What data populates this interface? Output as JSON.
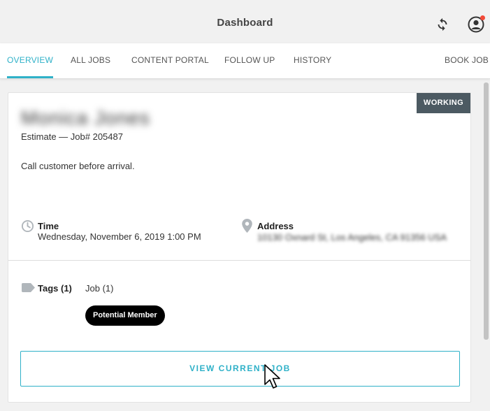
{
  "header": {
    "title": "Dashboard",
    "sync_icon": "sync-icon",
    "account_icon": "account-circle-icon",
    "notification_color": "#f24a38"
  },
  "tabs": [
    {
      "label": "OVERVIEW",
      "active": true
    },
    {
      "label": "ALL JOBS",
      "active": false
    },
    {
      "label": "CONTENT PORTAL",
      "active": false
    },
    {
      "label": "FOLLOW UP",
      "active": false
    },
    {
      "label": "HISTORY",
      "active": false
    },
    {
      "label": "BOOK JOB",
      "active": false
    }
  ],
  "job_card": {
    "status": "WORKING",
    "customer_name": "Monica Jones",
    "job_line": "Estimate — Job# 205487",
    "note": "Call customer before arrival.",
    "time": {
      "label": "Time",
      "value": "Wednesday, November 6, 2019 1:00 PM",
      "icon": "clock-icon"
    },
    "address": {
      "label": "Address",
      "value": "10130 Oxnard St, Los Angeles, CA 91356 USA",
      "icon": "map-pin-icon"
    },
    "tags": {
      "label": "Tags (1)",
      "icon": "tag-icon",
      "job_tags_label": "Job (1)",
      "items": [
        "Potential Member"
      ]
    },
    "view_button": "VIEW CURRENT JOB"
  },
  "colors": {
    "accent": "#2fb1c8",
    "status_badge": "#4c5a62",
    "tag_pill": "#000000"
  }
}
